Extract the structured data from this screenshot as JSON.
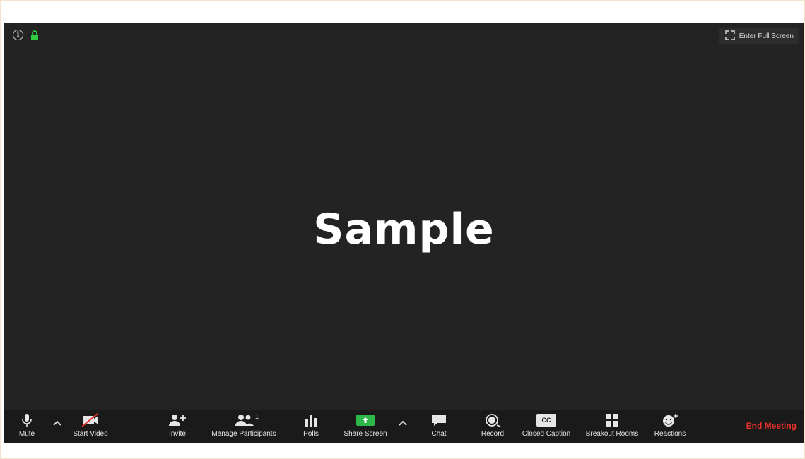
{
  "top": {
    "info_icon_glyph": "i",
    "fullscreen_label": "Enter Full Screen"
  },
  "main": {
    "label": "Sample"
  },
  "toolbar": {
    "mute_label": "Mute",
    "start_video_label": "Start Video",
    "invite_label": "Invite",
    "manage_participants_label": "Manage Participants",
    "participants_count": "1",
    "polls_label": "Polls",
    "share_screen_label": "Share Screen",
    "chat_label": "Chat",
    "record_label": "Record",
    "closed_caption_label": "Closed Caption",
    "cc_glyph": "CC",
    "breakout_rooms_label": "Breakout Rooms",
    "reactions_label": "Reactions",
    "end_meeting_label": "End Meeting"
  },
  "colors": {
    "background": "#232323",
    "toolbar": "#1a1a1a",
    "share_green": "#2fb84a",
    "end_red": "#e5302b",
    "lock_green": "#2ecc40"
  }
}
